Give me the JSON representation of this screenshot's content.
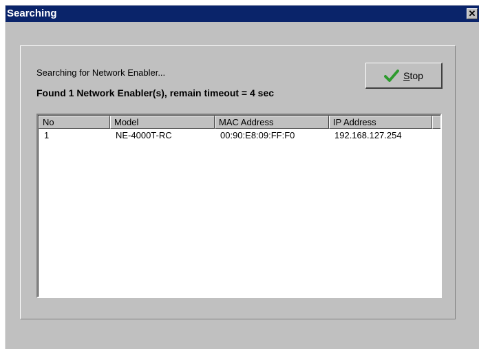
{
  "window": {
    "title": "Searching",
    "close_glyph": "✕"
  },
  "status": {
    "searching_text": "Searching for Network Enabler...",
    "found_text": "Found 1 Network Enabler(s), remain timeout = 4 sec"
  },
  "stop_button": {
    "label_underlined": "S",
    "label_rest": "top",
    "icon": "checkmark-icon",
    "icon_color": "#2e9b2e"
  },
  "table": {
    "columns": [
      "No",
      "Model",
      "MAC Address",
      "IP Address"
    ],
    "rows": [
      [
        "1",
        "NE-4000T-RC",
        "00:90:E8:09:FF:F0",
        "192.168.127.254"
      ]
    ]
  },
  "colors": {
    "titlebar": "#0a246a",
    "face": "#c0c0c0"
  }
}
